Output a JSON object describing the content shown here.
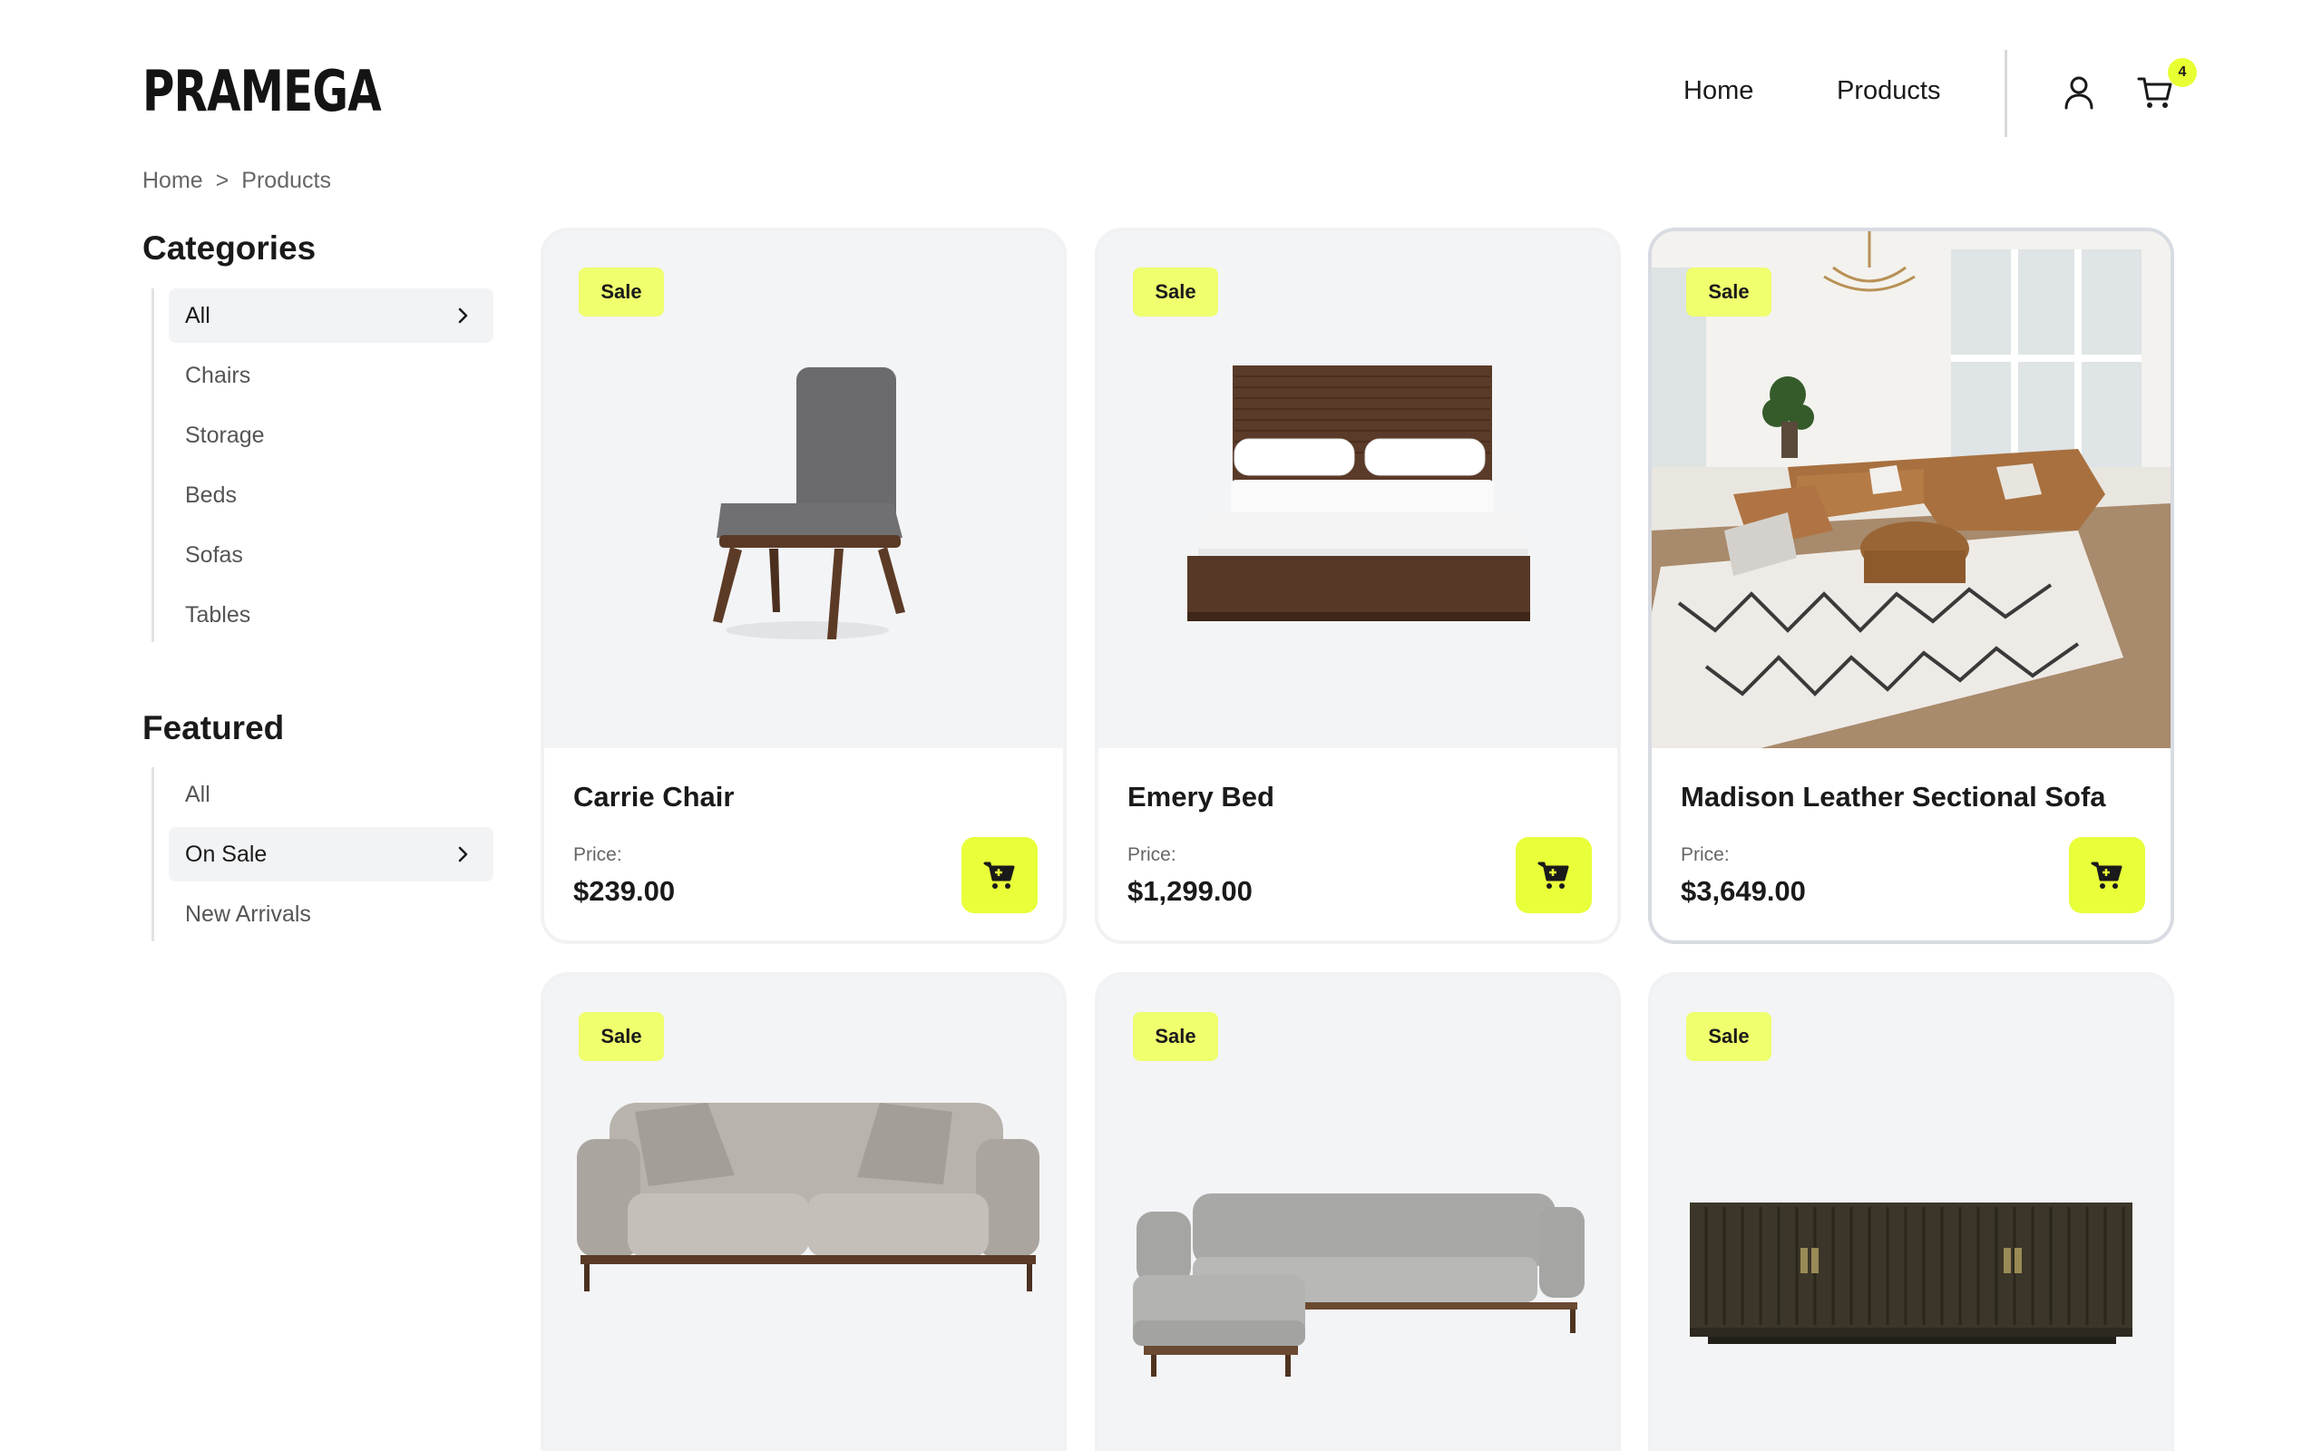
{
  "brand": {
    "logo": "PRAMEGA"
  },
  "nav": {
    "home": "Home",
    "products": "Products",
    "cart_count": "4"
  },
  "breadcrumb": {
    "items": [
      "Home",
      ">",
      "Products"
    ]
  },
  "sidebar": {
    "categories_title": "Categories",
    "categories": [
      {
        "label": "All",
        "active": true
      },
      {
        "label": "Chairs"
      },
      {
        "label": "Storage"
      },
      {
        "label": "Beds"
      },
      {
        "label": "Sofas"
      },
      {
        "label": "Tables"
      }
    ],
    "featured_title": "Featured",
    "featured": [
      {
        "label": "All"
      },
      {
        "label": "On Sale",
        "active": true
      },
      {
        "label": "New Arrivals"
      }
    ]
  },
  "products": [
    {
      "badge": "Sale",
      "name": "Carrie Chair",
      "price_label": "Price:",
      "price": "$239.00",
      "image": "chair"
    },
    {
      "badge": "Sale",
      "name": "Emery Bed",
      "price_label": "Price:",
      "price": "$1,299.00",
      "image": "bed"
    },
    {
      "badge": "Sale",
      "name": "Madison Leather Sectional Sofa",
      "price_label": "Price:",
      "price": "$3,649.00",
      "image": "living-room-sectional"
    },
    {
      "badge": "Sale",
      "image": "sofa"
    },
    {
      "badge": "Sale",
      "image": "sectional-sofa"
    },
    {
      "badge": "Sale",
      "image": "sideboard"
    }
  ],
  "colors": {
    "accent": "#e8ff3a",
    "card_bg": "#f3f4f6",
    "text": "#1a1a1a"
  },
  "icons": [
    "user-icon",
    "cart-icon",
    "chevron-right-icon",
    "add-to-cart-icon"
  ]
}
